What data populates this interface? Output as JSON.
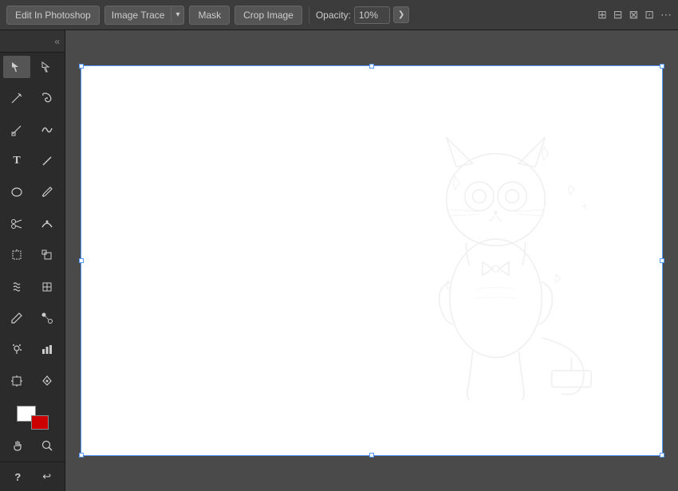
{
  "toolbar": {
    "edit_photoshop_label": "Edit In Photoshop",
    "image_trace_label": "Image Trace",
    "mask_label": "Mask",
    "crop_image_label": "Crop Image",
    "opacity_label": "Opacity:",
    "opacity_value": "10%",
    "dropdown_arrow": "▾",
    "chevron_right": "❯"
  },
  "tools_panel": {
    "collapse_icon": "«",
    "tools": [
      {
        "name": "select-tool",
        "icon": "▶",
        "label": "Selection Tool"
      },
      {
        "name": "direct-select-tool",
        "icon": "↗",
        "label": "Direct Selection Tool"
      },
      {
        "name": "pencil-tool",
        "icon": "✏",
        "label": "Pencil Tool"
      },
      {
        "name": "lasso-tool",
        "icon": "⊃",
        "label": "Lasso Tool"
      },
      {
        "name": "anchor-tool",
        "icon": "↗",
        "label": "Anchor Point Tool"
      },
      {
        "name": "smooth-tool",
        "icon": "⌓",
        "label": "Smooth Tool"
      },
      {
        "name": "type-tool",
        "icon": "T",
        "label": "Type Tool"
      },
      {
        "name": "line-tool",
        "icon": "/",
        "label": "Line Tool"
      },
      {
        "name": "ellipse-tool",
        "icon": "○",
        "label": "Ellipse Tool"
      },
      {
        "name": "paintbrush-tool",
        "icon": "✦",
        "label": "Paintbrush Tool"
      },
      {
        "name": "scissors-tool",
        "icon": "✂",
        "label": "Scissors Tool"
      },
      {
        "name": "curvature-tool",
        "icon": "⌒",
        "label": "Curvature Tool"
      },
      {
        "name": "free-transform-tool",
        "icon": "⟲",
        "label": "Free Transform Tool"
      },
      {
        "name": "scale-tool",
        "icon": "⊠",
        "label": "Scale Tool"
      },
      {
        "name": "warp-tool",
        "icon": "⌂",
        "label": "Warp Tool"
      },
      {
        "name": "mesh-tool",
        "icon": "⊞",
        "label": "Mesh Tool"
      },
      {
        "name": "eyedropper-tool",
        "icon": "⌇",
        "label": "Eyedropper Tool"
      },
      {
        "name": "blend-tool",
        "icon": "◈",
        "label": "Blend Tool"
      },
      {
        "name": "symbol-sprayer-tool",
        "icon": "⊕",
        "label": "Symbol Sprayer Tool"
      },
      {
        "name": "column-graph-tool",
        "icon": "▥",
        "label": "Column Graph Tool"
      },
      {
        "name": "artboard-tool",
        "icon": "⌗",
        "label": "Artboard Tool"
      },
      {
        "name": "pen-tool",
        "icon": "🖊",
        "label": "Pen Tool"
      },
      {
        "name": "hand-tool",
        "icon": "✋",
        "label": "Hand Tool"
      },
      {
        "name": "print-tiling-tool",
        "icon": "⊡",
        "label": "Print Tiling Tool"
      },
      {
        "name": "zoom-tool",
        "icon": "🔍",
        "label": "Zoom Tool"
      }
    ],
    "question_label": "?",
    "undo_label": "↩"
  },
  "toolbar_icons_right": [
    {
      "name": "arrange-icon",
      "icon": "⊞"
    },
    {
      "name": "align-icon",
      "icon": "⊟"
    },
    {
      "name": "distribute-icon",
      "icon": "⊠"
    },
    {
      "name": "more-icon",
      "icon": "⋯"
    }
  ]
}
